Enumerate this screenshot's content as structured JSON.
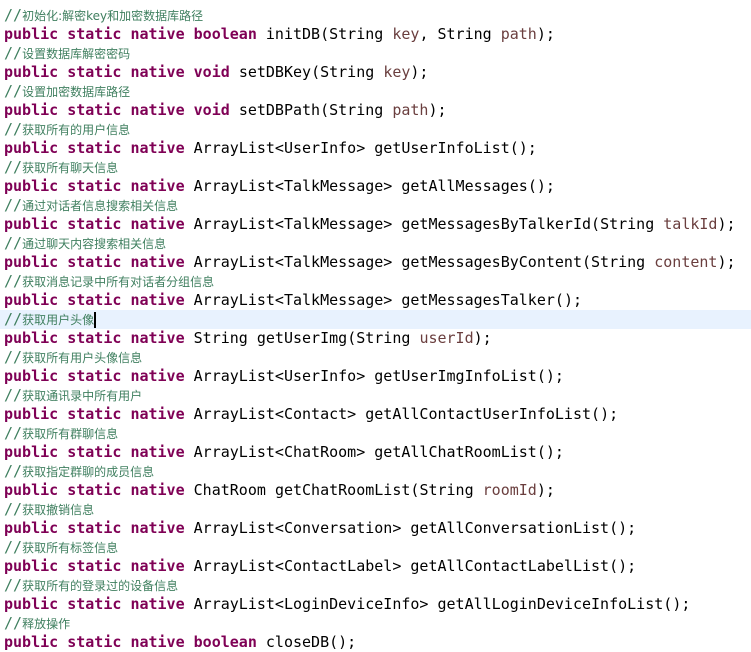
{
  "editor": {
    "colors": {
      "keyword": "#7F0055",
      "comment": "#3F7F5F",
      "param": "#6A3E3E",
      "highlight": "#E8F2FE"
    },
    "caret_line": 22,
    "lines": [
      {
        "c": "初始化:解密key和加密数据库路径"
      },
      {
        "ret": "boolean",
        "kwret": true,
        "name": "initDB",
        "params": [
          [
            "String",
            "key"
          ],
          [
            "String",
            "path"
          ]
        ]
      },
      {
        "c": "设置数据库解密密码"
      },
      {
        "ret": "void",
        "kwret": true,
        "name": "setDBKey",
        "params": [
          [
            "String",
            "key"
          ]
        ]
      },
      {
        "c": "设置加密数据库路径"
      },
      {
        "ret": "void",
        "kwret": true,
        "name": "setDBPath",
        "params": [
          [
            "String",
            "path"
          ]
        ]
      },
      {
        "c": "获取所有的用户信息"
      },
      {
        "ret": "ArrayList<UserInfo>",
        "name": "getUserInfoList",
        "params": []
      },
      {
        "c": "获取所有聊天信息"
      },
      {
        "ret": "ArrayList<TalkMessage>",
        "name": "getAllMessages",
        "params": []
      },
      {
        "c": "通过对话者信息搜索相关信息"
      },
      {
        "ret": "ArrayList<TalkMessage>",
        "name": "getMessagesByTalkerId",
        "params": [
          [
            "String",
            "talkId"
          ]
        ]
      },
      {
        "c": "通过聊天内容搜索相关信息"
      },
      {
        "ret": "ArrayList<TalkMessage>",
        "name": "getMessagesByContent",
        "params": [
          [
            "String",
            "content"
          ]
        ]
      },
      {
        "c": "获取消息记录中所有对话者分组信息"
      },
      {
        "ret": "ArrayList<TalkMessage>",
        "name": "getMessagesTalker",
        "params": []
      },
      {
        "c": "获取用户头像"
      },
      {
        "ret": "String",
        "name": "getUserImg",
        "params": [
          [
            "String",
            "userId"
          ]
        ]
      },
      {
        "c": "获取所有用户头像信息"
      },
      {
        "ret": "ArrayList<UserInfo>",
        "name": "getUserImgInfoList",
        "params": []
      },
      {
        "c": "获取通讯录中所有用户"
      },
      {
        "ret": "ArrayList<Contact>",
        "name": "getAllContactUserInfoList",
        "params": []
      },
      {
        "c": "获取所有群聊信息"
      },
      {
        "ret": "ArrayList<ChatRoom>",
        "name": "getAllChatRoomList",
        "params": []
      },
      {
        "c": "获取指定群聊的成员信息"
      },
      {
        "ret": "ChatRoom",
        "name": "getChatRoomList",
        "params": [
          [
            "String",
            "roomId"
          ]
        ]
      },
      {
        "c": "获取撤销信息"
      },
      {
        "ret": "ArrayList<Conversation>",
        "name": "getAllConversationList",
        "params": []
      },
      {
        "c": "获取所有标签信息"
      },
      {
        "ret": "ArrayList<ContactLabel>",
        "name": "getAllContactLabelList",
        "params": []
      },
      {
        "c": "获取所有的登录过的设备信息"
      },
      {
        "ret": "ArrayList<LoginDeviceInfo>",
        "name": "getAllLoginDeviceInfoList",
        "params": []
      },
      {
        "c": "释放操作"
      },
      {
        "ret": "boolean",
        "kwret": true,
        "name": "closeDB",
        "params": []
      }
    ],
    "modifiers": [
      "public",
      "static",
      "native"
    ]
  }
}
